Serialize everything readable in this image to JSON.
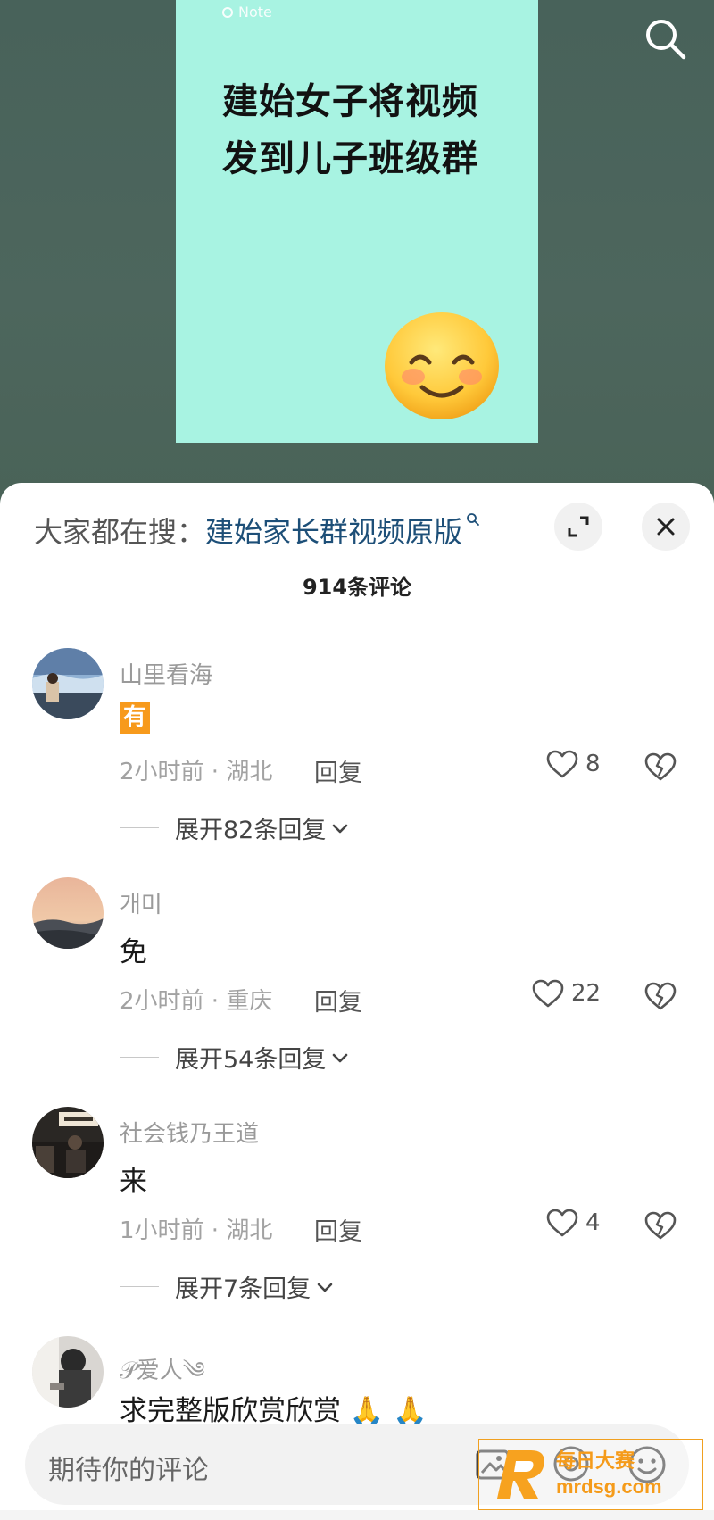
{
  "note": {
    "tag": "Note",
    "title": "建始女子将视频发到儿子班级群"
  },
  "header": {
    "hot_prefix": "大家都在搜：",
    "hot_query": "建始家长群视频原版",
    "comment_count": "914条评论"
  },
  "comments": [
    {
      "username": "山里看海",
      "text": "有",
      "time_location": "2小时前 · 湖北",
      "reply_label": "回复",
      "likes": "8",
      "expand": "展开82条回复"
    },
    {
      "username": "개미",
      "text": "免",
      "time_location": "2小时前 · 重庆",
      "reply_label": "回复",
      "likes": "22",
      "expand": "展开54条回复"
    },
    {
      "username": "社会钱乃王道",
      "text": "来",
      "time_location": "1小时前 · 湖北",
      "reply_label": "回复",
      "likes": "4",
      "expand": "展开7条回复"
    },
    {
      "username": "𝒫爱人༄",
      "text": "求完整版欣赏欣赏 🙏 🙏"
    }
  ],
  "input": {
    "placeholder": "期待你的评论"
  },
  "watermark": {
    "name": "每日大赛",
    "url": "mrdsg.com"
  },
  "colors": {
    "background": "#4b6558",
    "note_card": "#a8f3e2",
    "link": "#1d4f78",
    "badge": "#f79a1c"
  }
}
